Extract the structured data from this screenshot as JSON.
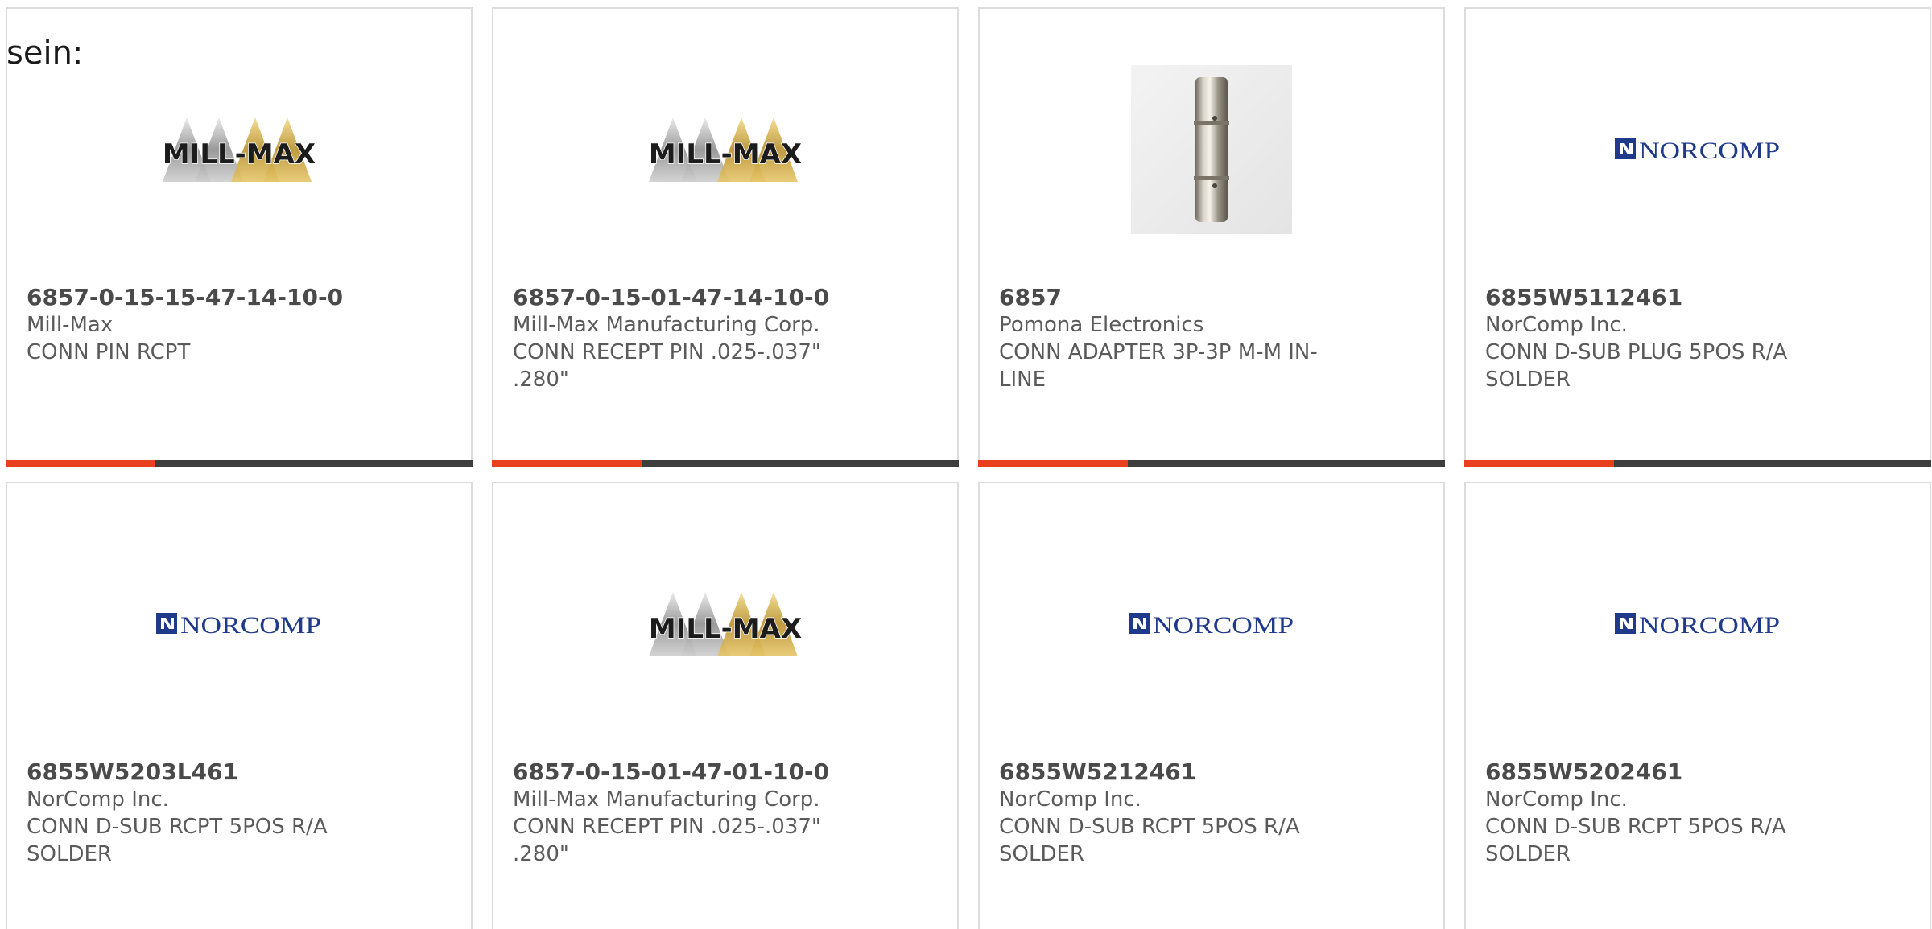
{
  "intro_text": "sein:",
  "colors": {
    "accent": "#e8401c",
    "bar": "#3d3d3d",
    "border": "#dcdcdc",
    "norcomp_blue": "#1f3a8a"
  },
  "logos": {
    "millmax": "MILL-MAX",
    "norcomp": "NORCOMP"
  },
  "products": [
    {
      "part_number": "6857-0-15-15-47-14-10-0",
      "manufacturer": "Mill-Max",
      "description": "CONN PIN RCPT",
      "image": "millmax-logo",
      "accent_fraction": 0.32
    },
    {
      "part_number": "6857-0-15-01-47-14-10-0",
      "manufacturer": "Mill-Max Manufacturing Corp.",
      "description": "CONN RECEPT PIN .025-.037\" .280\"",
      "image": "millmax-logo",
      "accent_fraction": 0.32
    },
    {
      "part_number": "6857",
      "manufacturer": "Pomona Electronics",
      "description": "CONN ADAPTER 3P-3P M-M IN-LINE",
      "image": "adapter-photo",
      "accent_fraction": 0.32
    },
    {
      "part_number": "6855W5112461",
      "manufacturer": "NorComp Inc.",
      "description": "CONN D-SUB PLUG 5POS R/A SOLDER",
      "image": "norcomp-logo",
      "accent_fraction": 0.32
    },
    {
      "part_number": "6855W5203L461",
      "manufacturer": "NorComp Inc.",
      "description": "CONN D-SUB RCPT 5POS R/A SOLDER",
      "image": "norcomp-logo"
    },
    {
      "part_number": "6857-0-15-01-47-01-10-0",
      "manufacturer": "Mill-Max Manufacturing Corp.",
      "description": "CONN RECEPT PIN .025-.037\" .280\"",
      "image": "millmax-logo"
    },
    {
      "part_number": "6855W5212461",
      "manufacturer": "NorComp Inc.",
      "description": "CONN D-SUB RCPT 5POS R/A SOLDER",
      "image": "norcomp-logo"
    },
    {
      "part_number": "6855W5202461",
      "manufacturer": "NorComp Inc.",
      "description": "CONN D-SUB RCPT 5POS R/A SOLDER",
      "image": "norcomp-logo"
    }
  ]
}
